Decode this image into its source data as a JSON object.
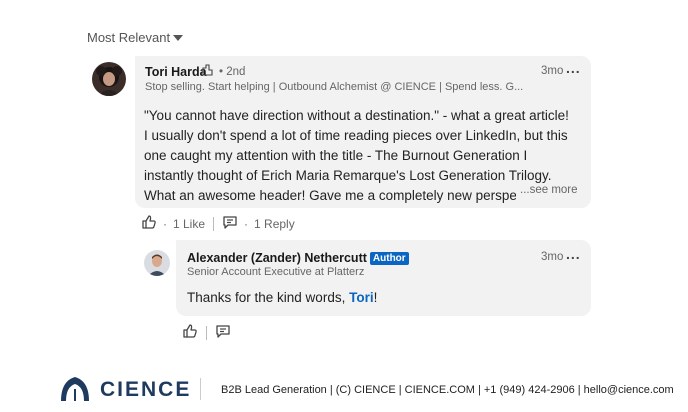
{
  "sort": {
    "label": "Most Relevant"
  },
  "comment": {
    "author": "Tori Harda",
    "degree": "• 2nd",
    "headline": "Stop selling. Start helping | Outbound Alchemist @ CIENCE | Spend less. G...",
    "time": "3mo",
    "more_label": "...",
    "lines": [
      "\"You cannot have direction without a destination.\" - what a great article!",
      "I usually don't spend a lot of time reading pieces over LinkedIn, but this",
      "one caught my attention with the title - The Burnout Generation I",
      "instantly thought of Erich Maria Remarque's Lost Generation Trilogy.",
      "What an awesome header! Gave me a completely new perspec"
    ],
    "see_more": "...see more",
    "like_count": "1 Like",
    "reply_count": "1 Reply"
  },
  "reply": {
    "author": "Alexander (Zander) Nethercutt",
    "badge": "Author",
    "headline": "Senior Account Executive at Platterz",
    "time": "3mo",
    "more_label": "...",
    "text_before": "Thanks for the kind words, ",
    "mention": "Tori",
    "text_after": "!"
  },
  "footer": {
    "logo": "CIENCE",
    "text": "B2B Lead Generation | (C) CIENCE | CIENCE.COM | +1 (949) 424-2906 | hello@cience.com"
  },
  "icons": {
    "sort_caret": "caret-down-icon",
    "like": "thumbs-up-icon",
    "reply": "speech-bubble-icon",
    "more": "ellipsis-icon",
    "badge": "sparkle-badge-icon",
    "logo": "cience-logo-icon"
  },
  "colors": {
    "accent": "#0a66c2",
    "bubble": "#f2f2f2",
    "logo": "#1f3a5f"
  }
}
